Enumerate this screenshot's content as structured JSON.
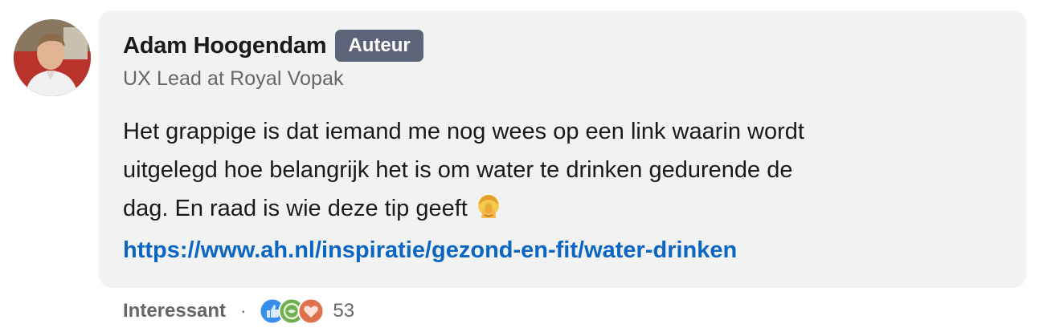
{
  "comment": {
    "author": {
      "name": "Adam Hoogendam",
      "badge": "Auteur",
      "headline": "UX Lead at Royal Vopak",
      "avatar_icon": "person-avatar"
    },
    "body_lines": [
      "Het grappige is dat iemand me nog wees op een link waarin wordt",
      "uitgelegd hoe belangrijk het is om water te drinken gedurende de",
      "dag. En raad is wie deze tip geeft"
    ],
    "emoji_icon": "facepalm-emoji-icon",
    "link": "https://www.ah.nl/inspiratie/gezond-en-fit/water-drinken"
  },
  "actions": {
    "reaction_label": "Interessant",
    "separator": "·",
    "reaction_icons": [
      "like-icon",
      "insightful-icon",
      "love-icon"
    ],
    "reaction_count": "53"
  },
  "colors": {
    "bubble": "#f2f2f2",
    "badge": "#5b6478",
    "link": "#0a66c2",
    "muted_text": "#666666"
  }
}
